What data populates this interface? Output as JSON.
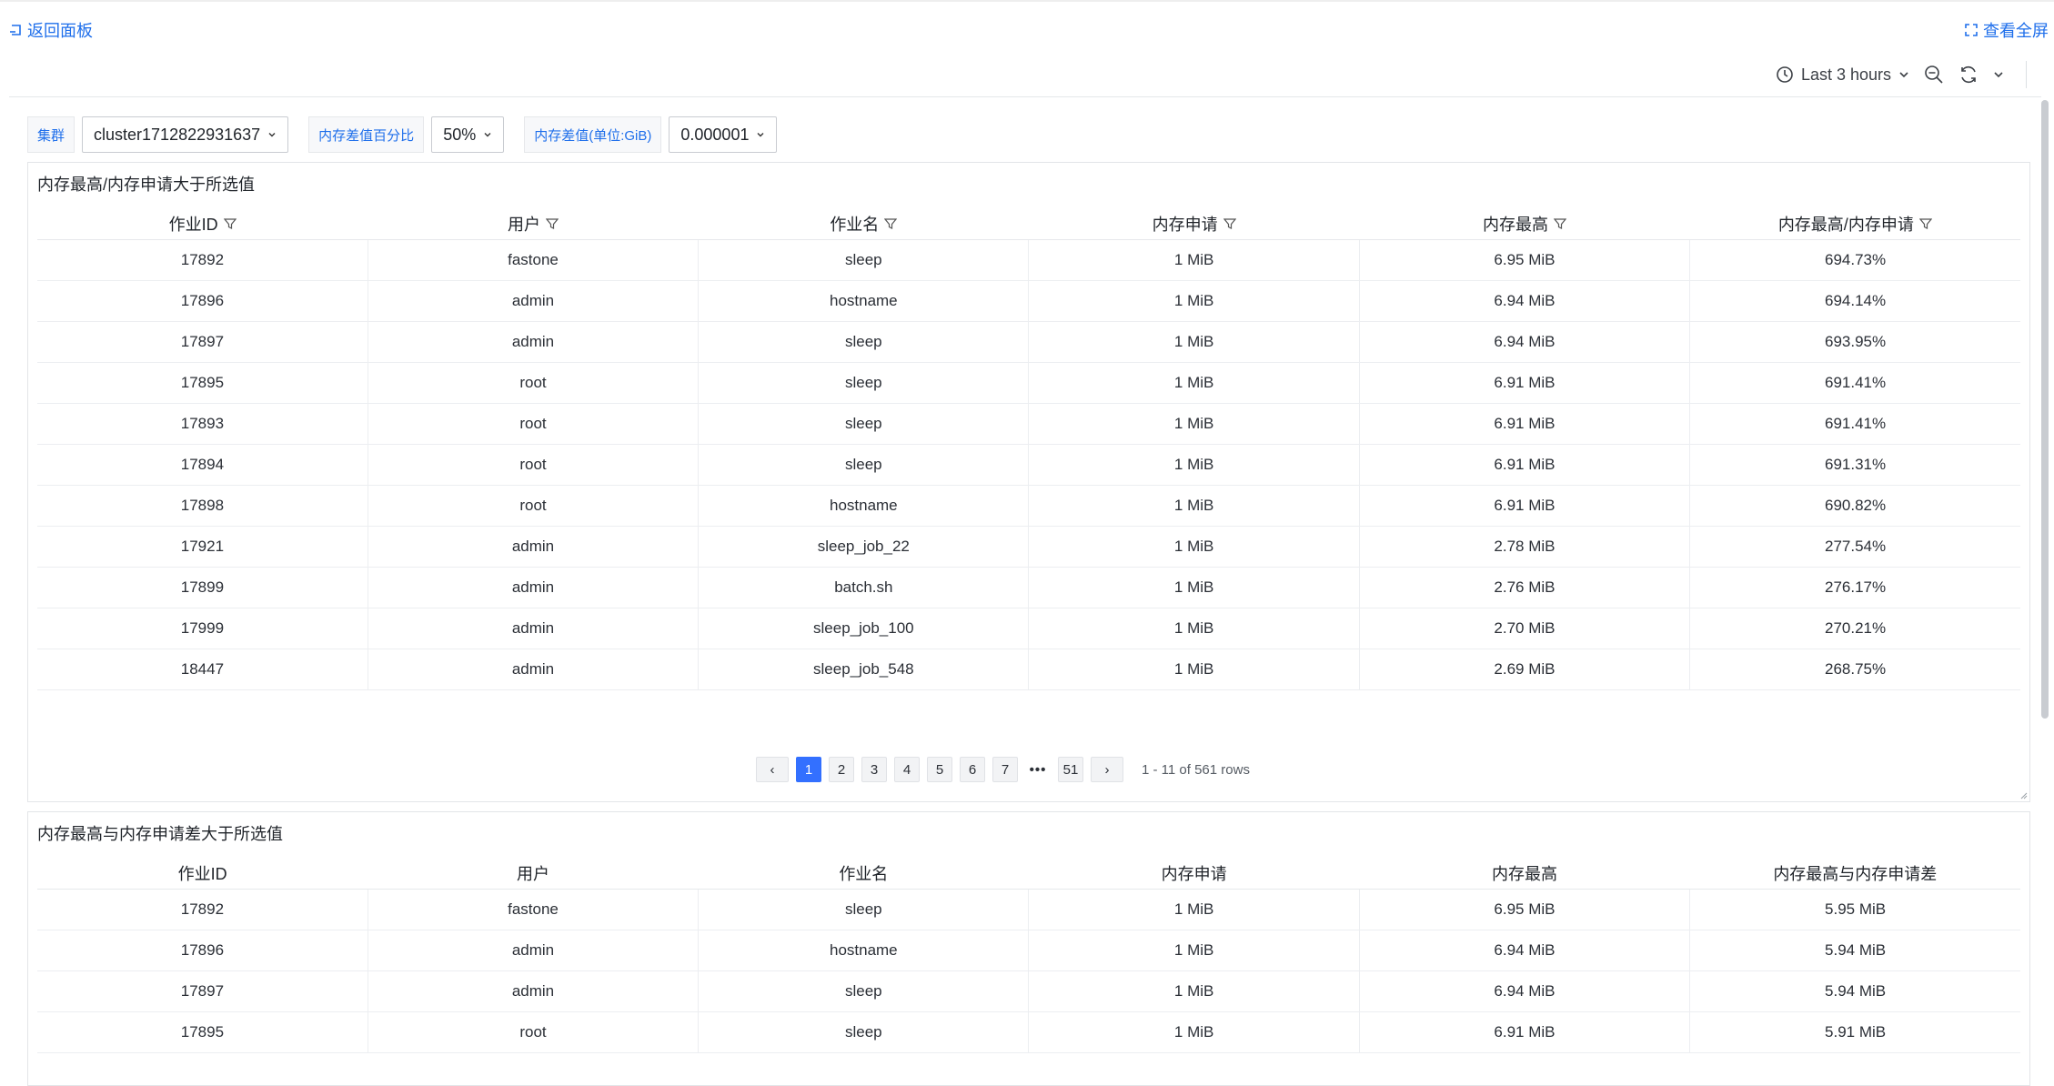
{
  "nav": {
    "back_label": "返回面板",
    "fullscreen_label": "查看全屏"
  },
  "toolbar": {
    "time_range": "Last 3 hours"
  },
  "filters": [
    {
      "label": "集群",
      "value": "cluster1712822931637"
    },
    {
      "label": "内存差值百分比",
      "value": "50%"
    },
    {
      "label": "内存差值(单位:GiB)",
      "value": "0.000001"
    }
  ],
  "panel1": {
    "title": "内存最高/内存申请大于所选值",
    "columns": [
      "作业ID",
      "用户",
      "作业名",
      "内存申请",
      "内存最高",
      "内存最高/内存申请"
    ],
    "rows": [
      [
        "17892",
        "fastone",
        "sleep",
        "1 MiB",
        "6.95 MiB",
        "694.73%"
      ],
      [
        "17896",
        "admin",
        "hostname",
        "1 MiB",
        "6.94 MiB",
        "694.14%"
      ],
      [
        "17897",
        "admin",
        "sleep",
        "1 MiB",
        "6.94 MiB",
        "693.95%"
      ],
      [
        "17895",
        "root",
        "sleep",
        "1 MiB",
        "6.91 MiB",
        "691.41%"
      ],
      [
        "17893",
        "root",
        "sleep",
        "1 MiB",
        "6.91 MiB",
        "691.41%"
      ],
      [
        "17894",
        "root",
        "sleep",
        "1 MiB",
        "6.91 MiB",
        "691.31%"
      ],
      [
        "17898",
        "root",
        "hostname",
        "1 MiB",
        "6.91 MiB",
        "690.82%"
      ],
      [
        "17921",
        "admin",
        "sleep_job_22",
        "1 MiB",
        "2.78 MiB",
        "277.54%"
      ],
      [
        "17899",
        "admin",
        "batch.sh",
        "1 MiB",
        "2.76 MiB",
        "276.17%"
      ],
      [
        "17999",
        "admin",
        "sleep_job_100",
        "1 MiB",
        "2.70 MiB",
        "270.21%"
      ],
      [
        "18447",
        "admin",
        "sleep_job_548",
        "1 MiB",
        "2.69 MiB",
        "268.75%"
      ]
    ],
    "pagination": {
      "prev": "‹",
      "pages": [
        "1",
        "2",
        "3",
        "4",
        "5",
        "6",
        "7"
      ],
      "ellipsis": "•••",
      "last_page": "51",
      "next": "›",
      "current": "1",
      "info": "1 - 11 of 561 rows"
    }
  },
  "panel2": {
    "title": "内存最高与内存申请差大于所选值",
    "columns": [
      "作业ID",
      "用户",
      "作业名",
      "内存申请",
      "内存最高",
      "内存最高与内存申请差"
    ],
    "rows": [
      [
        "17892",
        "fastone",
        "sleep",
        "1 MiB",
        "6.95 MiB",
        "5.95 MiB"
      ],
      [
        "17896",
        "admin",
        "hostname",
        "1 MiB",
        "6.94 MiB",
        "5.94 MiB"
      ],
      [
        "17897",
        "admin",
        "sleep",
        "1 MiB",
        "6.94 MiB",
        "5.94 MiB"
      ],
      [
        "17895",
        "root",
        "sleep",
        "1 MiB",
        "6.91 MiB",
        "5.91 MiB"
      ]
    ]
  },
  "colors": {
    "link": "#1f6feb",
    "ratio_text": "#e0304e",
    "active_page": "#3370ff"
  },
  "icons": [
    "back-icon",
    "fullscreen-icon",
    "clock-icon",
    "chevron-down-icon",
    "zoom-out-icon",
    "refresh-icon",
    "filter-icon"
  ]
}
